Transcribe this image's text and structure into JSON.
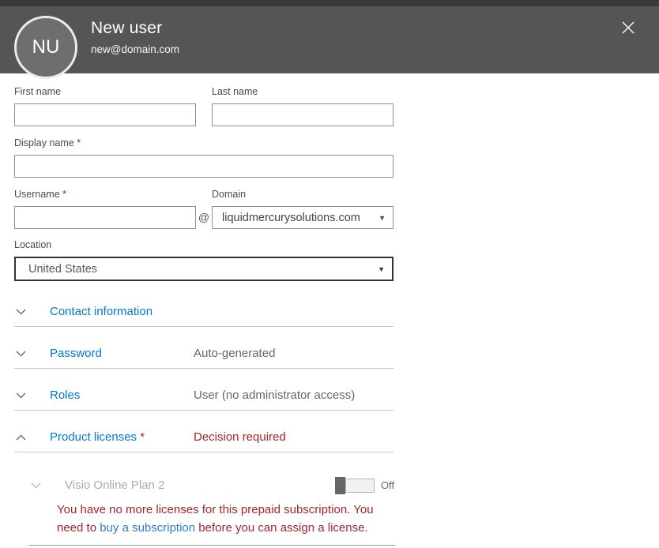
{
  "header": {
    "initials": "NU",
    "title": "New user",
    "subtitle": "new@domain.com"
  },
  "form": {
    "first_name_label": "First name",
    "first_name_value": "",
    "last_name_label": "Last name",
    "last_name_value": "",
    "display_name_label": "Display name",
    "display_name_value": "",
    "username_label": "Username",
    "username_value": "",
    "required_marker": "*",
    "at_symbol": "@",
    "domain_label": "Domain",
    "domain_value": "liquidmercurysolutions.com",
    "location_label": "Location",
    "location_value": "United States",
    "dropdown_caret": "▼"
  },
  "sections": {
    "contact": {
      "label": "Contact information",
      "value": ""
    },
    "password": {
      "label": "Password",
      "value": "Auto-generated"
    },
    "roles": {
      "label": "Roles",
      "value": "User (no administrator access)"
    },
    "licenses": {
      "label": "Product licenses",
      "required": "*",
      "value": "Decision required"
    }
  },
  "license": {
    "name": "Visio Online Plan 2",
    "toggle_state": "Off",
    "warning_before": "You have no more licenses for this prepaid subscription. You need to ",
    "warning_link": "buy a subscription",
    "warning_after": " before you can assign a license."
  },
  "colors": {
    "header_bg": "#555555",
    "accent_blue": "#0078d7",
    "error_red": "#a4262c",
    "disabled_text": "#ababab"
  }
}
